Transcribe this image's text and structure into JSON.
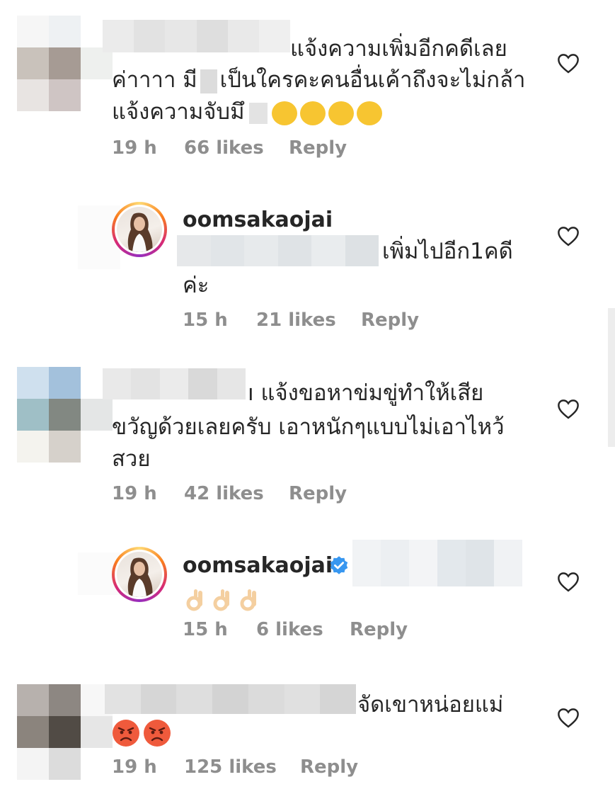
{
  "colors": {
    "text": "#262626",
    "meta": "#8e8e8e",
    "verified": "#3897f0",
    "heart_outline": "#262626"
  },
  "comments": [
    {
      "text_line1": "แจ้งความเพิ่มอีกคดีเลย",
      "text_line2_a": "ค่าาาา มี",
      "text_line2_b": "เป็นใครคะคนอื่นเค้าถึงจะไม่กล้า",
      "text_line3": "แจ้งความจับมึ",
      "emojis": [
        "laugh-cry-emoji",
        "laugh-cry-emoji",
        "laugh-cry-emoji",
        "laugh-cry-emoji"
      ],
      "time": "19 h",
      "likes": "66 likes",
      "reply": "Reply",
      "like_icon": "heart-outline-icon"
    },
    {
      "username": "oomsakaojai",
      "text_line1": "เพิ่มไปอีก1คดี",
      "text_line2": "ค่ะ",
      "time": "15 h",
      "likes": "21 likes",
      "reply": "Reply",
      "like_icon": "heart-outline-icon"
    },
    {
      "text_line1": "แจ้งขอหาข่มขู่ทำให้เสีย",
      "text_line1_prefix": "ı",
      "text_line2": "ขวัญด้วยเลยครับ เอาหนักๆแบบไม่เอาไหว้",
      "text_line3": "สวย",
      "time": "19 h",
      "likes": "42 likes",
      "reply": "Reply",
      "like_icon": "heart-outline-icon"
    },
    {
      "username": "oomsakaojai",
      "verified_icon": "verified-badge-icon",
      "emojis": [
        "ok-hand-emoji",
        "ok-hand-emoji",
        "ok-hand-emoji"
      ],
      "time": "15 h",
      "likes": "6 likes",
      "reply": "Reply",
      "like_icon": "heart-outline-icon"
    },
    {
      "text_line1": "จัดเขาหน่อยแม่",
      "emojis": [
        "angry-face-emoji",
        "angry-face-emoji"
      ],
      "time": "19 h",
      "likes": "125 likes",
      "reply": "Reply",
      "like_icon": "heart-outline-icon"
    }
  ]
}
